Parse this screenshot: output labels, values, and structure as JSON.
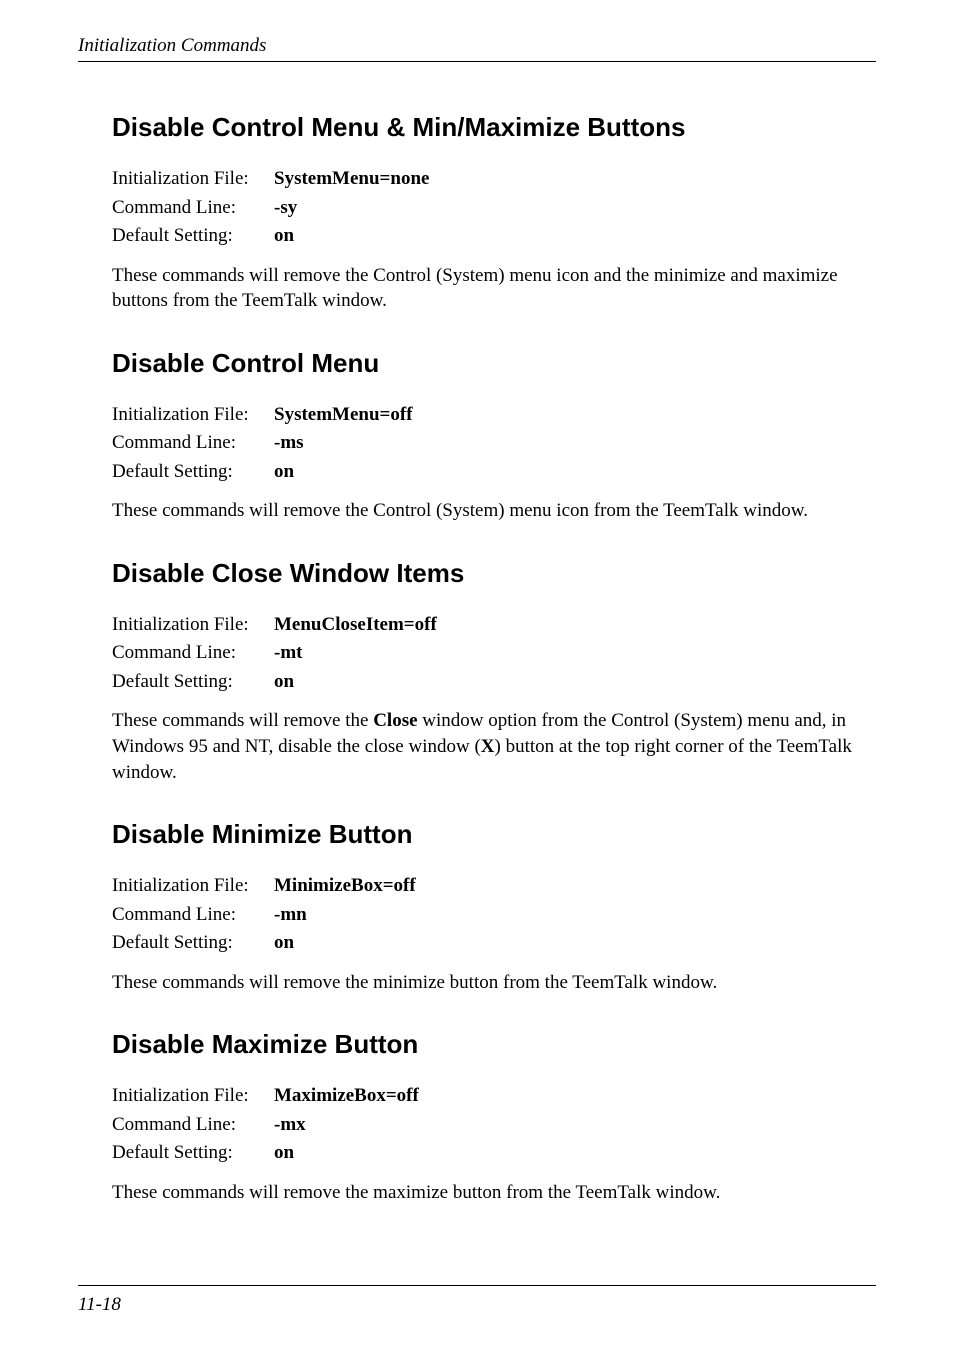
{
  "header": {
    "running": "Initialization Commands"
  },
  "sections": [
    {
      "heading": "Disable Control Menu & Min/Maximize Buttons",
      "init_file": "SystemMenu=none",
      "cmd_line": "-sy",
      "default": "on",
      "body_pre": "These commands will remove the Control (System) menu icon and the minimize and maximize buttons from the TeemTalk window.",
      "body_bold1": "",
      "body_mid": "",
      "body_bold2": "",
      "body_post": ""
    },
    {
      "heading": "Disable Control Menu",
      "init_file": "SystemMenu=off",
      "cmd_line": "-ms",
      "default": "on",
      "body_pre": "These commands will remove the Control (System) menu icon from the TeemTalk window.",
      "body_bold1": "",
      "body_mid": "",
      "body_bold2": "",
      "body_post": ""
    },
    {
      "heading": "Disable Close Window Items",
      "init_file": "MenuCloseItem=off",
      "cmd_line": "-mt",
      "default": "on",
      "body_pre": "These commands will remove the ",
      "body_bold1": "Close",
      "body_mid": " window option from the Control (System) menu and, in Windows 95 and NT, disable the close window (",
      "body_bold2": "X",
      "body_post": ") button at the top right corner of the TeemTalk window."
    },
    {
      "heading": "Disable Minimize Button",
      "init_file": "MinimizeBox=off",
      "cmd_line": "-mn",
      "default": "on",
      "body_pre": "These commands will remove the minimize button from the TeemTalk window.",
      "body_bold1": "",
      "body_mid": "",
      "body_bold2": "",
      "body_post": ""
    },
    {
      "heading": "Disable Maximize Button",
      "init_file": "MaximizeBox=off",
      "cmd_line": "-mx",
      "default": "on",
      "body_pre": "These commands will remove the maximize button from the TeemTalk window.",
      "body_bold1": "",
      "body_mid": "",
      "body_bold2": "",
      "body_post": ""
    }
  ],
  "labels": {
    "init_file": "Initialization File:",
    "cmd_line": "Command Line:",
    "default": "Default Setting:"
  },
  "footer": {
    "page": "11-18"
  }
}
